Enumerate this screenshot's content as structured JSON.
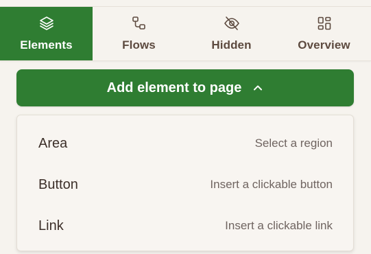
{
  "tabs": [
    {
      "label": "Elements",
      "icon": "layers-icon",
      "active": true
    },
    {
      "label": "Flows",
      "icon": "flow-icon",
      "active": false
    },
    {
      "label": "Hidden",
      "icon": "eye-off-icon",
      "active": false
    },
    {
      "label": "Overview",
      "icon": "grid-icon",
      "active": false
    }
  ],
  "add_button": {
    "label": "Add element to page",
    "icon": "chevron-up-icon"
  },
  "menu": {
    "items": [
      {
        "label": "Area",
        "description": "Select a region"
      },
      {
        "label": "Button",
        "description": "Insert a clickable button"
      },
      {
        "label": "Link",
        "description": "Insert a clickable link"
      }
    ]
  },
  "colors": {
    "accent": "#2f7d32",
    "background": "#f6f3ee",
    "tab_text": "#5d4a3f",
    "menu_text": "#3c2f29",
    "menu_desc": "#6f6460"
  }
}
